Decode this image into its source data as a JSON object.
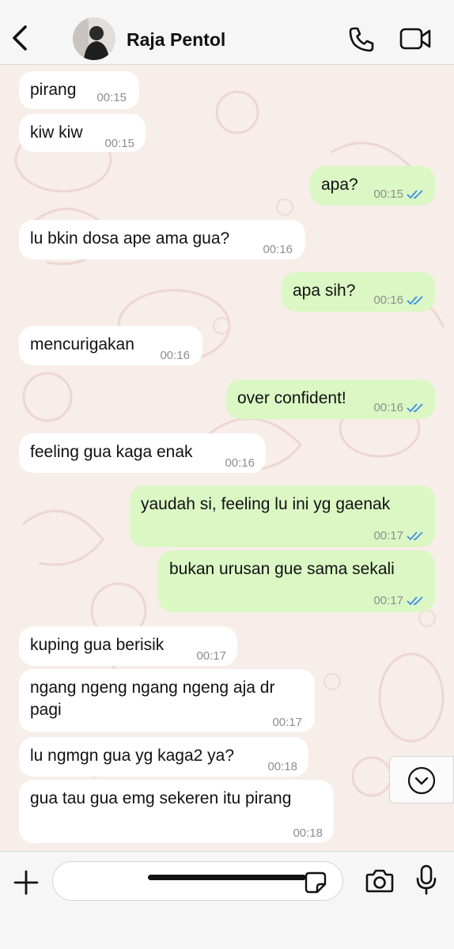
{
  "header": {
    "back_icon": "chevron-left-icon",
    "contact_name": "Raja Pentol",
    "call_icon": "phone-icon",
    "video_icon": "video-camera-icon"
  },
  "messages": [
    {
      "dir": "in",
      "text": "pirang",
      "time": "00:15"
    },
    {
      "dir": "in",
      "text": "kiw kiw",
      "time": "00:15"
    },
    {
      "dir": "out",
      "text": "apa?",
      "time": "00:15",
      "status": "read"
    },
    {
      "dir": "in",
      "text": "lu bkin dosa ape ama gua?",
      "time": "00:16"
    },
    {
      "dir": "out",
      "text": "apa sih?",
      "time": "00:16",
      "status": "read"
    },
    {
      "dir": "in",
      "text": "mencurigakan",
      "time": "00:16"
    },
    {
      "dir": "out",
      "text": "over confident!",
      "time": "00:16",
      "status": "read"
    },
    {
      "dir": "in",
      "text": "feeling gua kaga enak",
      "time": "00:16"
    },
    {
      "dir": "out",
      "text": "yaudah si, feeling lu ini yg gaenak",
      "time": "00:17",
      "status": "read"
    },
    {
      "dir": "out",
      "text": "bukan urusan gue sama sekali",
      "time": "00:17",
      "status": "read"
    },
    {
      "dir": "in",
      "text": "kuping gua berisik",
      "time": "00:17"
    },
    {
      "dir": "in",
      "text": "ngang ngeng ngang ngeng aja dr pagi",
      "time": "00:17"
    },
    {
      "dir": "in",
      "text": "lu ngmgn gua yg kaga2 ya?",
      "time": "00:18"
    },
    {
      "dir": "in",
      "text": "gua tau gua emg sekeren itu pirang",
      "time": "00:18"
    }
  ],
  "composer": {
    "input_value": "",
    "attach_icon": "plus-icon",
    "sticker_icon": "sticker-icon",
    "camera_icon": "camera-icon",
    "mic_icon": "microphone-icon"
  },
  "scroll_down_icon": "chevron-down-circle-icon",
  "colors": {
    "incoming_bubble": "#ffffff",
    "outgoing_bubble": "#daf7c4",
    "read_ticks": "#3e8de6",
    "wallpaper": "#f7ede9"
  }
}
